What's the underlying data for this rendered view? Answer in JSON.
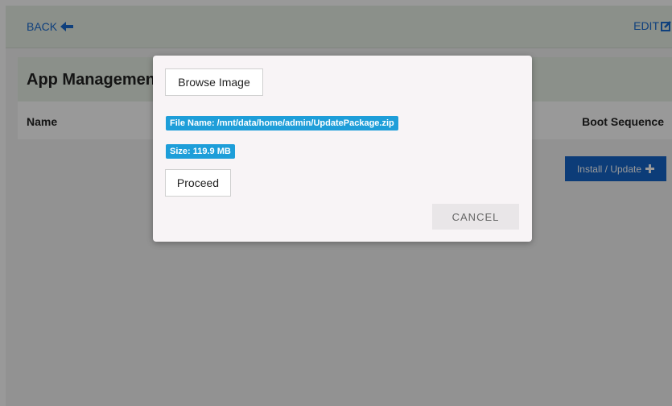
{
  "topbar": {
    "back_label": "BACK",
    "back_icon": "arrow-left-icon",
    "edit_label": "EDIT",
    "edit_icon": "edit-icon"
  },
  "panel": {
    "title": "App Management",
    "columns": [
      "Name",
      "Boot Sequence"
    ],
    "install_button_label": "Install / Update",
    "install_icon": "plus-icon"
  },
  "dialog": {
    "browse_label": "Browse Image",
    "file_name": "File Name: /mnt/data/home/admin/UpdatePackage.zip",
    "size": "Size: 119.9 MB",
    "proceed_label": "Proceed",
    "cancel_label": "CANCEL"
  },
  "colors": {
    "accent": "#1565c9",
    "badge": "#1e9ed9",
    "link": "#1a6bd0"
  }
}
